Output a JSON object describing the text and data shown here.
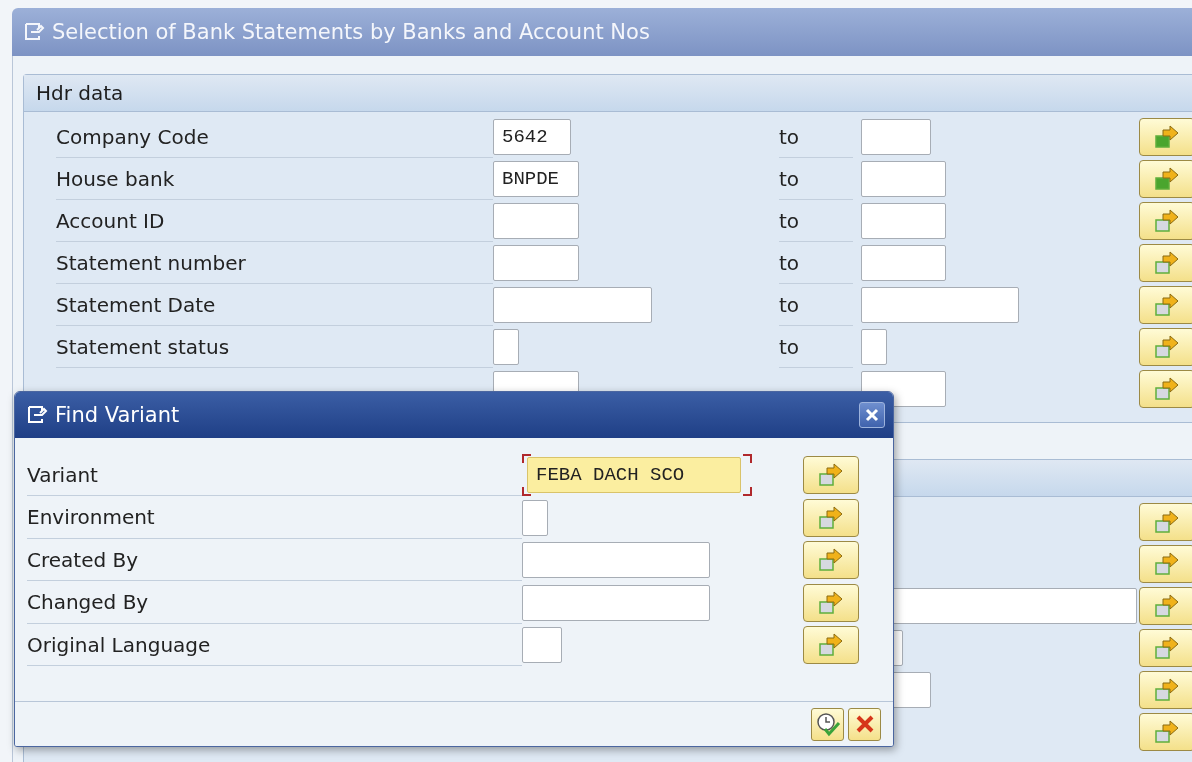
{
  "screen": {
    "title": "Selection of Bank Statements by Banks and Account Nos"
  },
  "header_group": {
    "title": "Hdr data",
    "rows": [
      {
        "label": "Company Code",
        "low": "5642",
        "to": "to",
        "has_selection": true
      },
      {
        "label": "House bank",
        "low": "BNPDE",
        "to": "to",
        "has_selection": true
      },
      {
        "label": "Account ID",
        "to": "to",
        "has_selection": false
      },
      {
        "label": "Statement number",
        "to": "to",
        "has_selection": false
      },
      {
        "label": "Statement Date",
        "to": "to",
        "has_selection": false
      },
      {
        "label": "Statement status",
        "to": "to",
        "has_selection": false
      },
      {
        "has_selection": false
      }
    ]
  },
  "second_group": {
    "rows": [
      {
        "has_selection": false
      },
      {
        "has_selection": false
      },
      {
        "has_selection": false
      },
      {
        "has_selection": false
      },
      {
        "has_selection": false
      },
      {
        "has_selection": false
      }
    ]
  },
  "dialog": {
    "title": "Find Variant",
    "rows": [
      {
        "label": "Variant",
        "value": "FEBA DACH SCO",
        "focused": true
      },
      {
        "label": "Environment",
        "focused": false
      },
      {
        "label": "Created By",
        "focused": false
      },
      {
        "label": "Changed By",
        "focused": false
      },
      {
        "label": "Original Language",
        "focused": false
      }
    ]
  }
}
